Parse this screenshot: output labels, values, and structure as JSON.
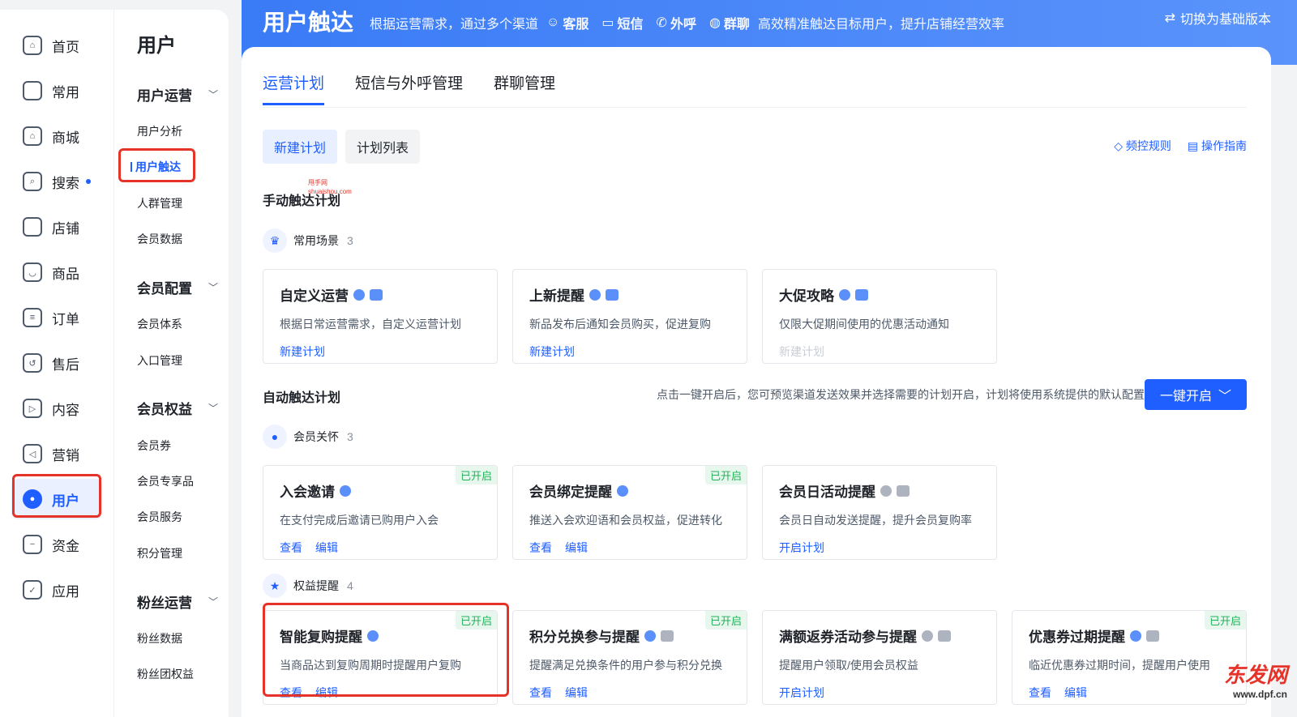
{
  "rail": {
    "items": [
      {
        "label": "首页",
        "icon": "home-icon"
      },
      {
        "label": "常用",
        "icon": "folder-icon"
      },
      {
        "label": "商城",
        "icon": "store-icon"
      },
      {
        "label": "搜索",
        "icon": "search-icon"
      },
      {
        "label": "店铺",
        "icon": "shop-icon"
      },
      {
        "label": "商品",
        "icon": "bag-icon"
      },
      {
        "label": "订单",
        "icon": "order-icon"
      },
      {
        "label": "售后",
        "icon": "aftersale-icon"
      },
      {
        "label": "内容",
        "icon": "content-icon"
      },
      {
        "label": "营销",
        "icon": "megaphone-icon"
      },
      {
        "label": "用户",
        "icon": "user-icon"
      },
      {
        "label": "资金",
        "icon": "wallet-icon"
      },
      {
        "label": "应用",
        "icon": "app-icon"
      }
    ]
  },
  "subnav": {
    "title": "用户",
    "groups": [
      "用户运营",
      "会员配置",
      "会员权益",
      "粉丝运营"
    ],
    "items": [
      "用户分析",
      "用户触达",
      "人群管理",
      "会员数据",
      "会员体系",
      "入口管理",
      "会员券",
      "会员专享品",
      "会员服务",
      "积分管理",
      "粉丝数据",
      "粉丝团权益"
    ]
  },
  "banner": {
    "title": "用户触达",
    "desc_prefix": "根据运营需求，通过多个渠道",
    "channels": [
      "客服",
      "短信",
      "外呼",
      "群聊"
    ],
    "desc_suffix": "高效精准触达目标用户，提升店铺经营效率",
    "switch": "切换为基础版本"
  },
  "tabs": [
    "运营计划",
    "短信与外呼管理",
    "群聊管理"
  ],
  "seg": [
    "新建计划",
    "计划列表"
  ],
  "links": [
    "频控规则",
    "操作指南"
  ],
  "manual": {
    "title": "手动触达计划",
    "watermark_1": "甩手网",
    "watermark_2": "shuaishou.com",
    "category": "常用场景",
    "count": "3",
    "cards": [
      {
        "title": "自定义运营",
        "desc": "根据日常运营需求，自定义运营计划",
        "action": "新建计划"
      },
      {
        "title": "上新提醒",
        "desc": "新品发布后通知会员购买，促进复购",
        "action": "新建计划"
      },
      {
        "title": "大促攻略",
        "desc": "仅限大促期间使用的优惠活动通知",
        "action": "新建计划"
      }
    ]
  },
  "auto": {
    "title": "自动触达计划",
    "note": "点击一键开启后，您可预览渠道发送效果并选择需要的计划开启，计划将使用系统提供的默认配置",
    "button": "一键开启",
    "cat1": {
      "label": "会员关怀",
      "count": "3"
    },
    "cat2": {
      "label": "权益提醒",
      "count": "4"
    },
    "badge": "已开启",
    "view": "查看",
    "edit": "编辑",
    "enable": "开启计划",
    "cards1": [
      {
        "title": "入会邀请",
        "desc": "在支付完成后邀请已购用户入会"
      },
      {
        "title": "会员绑定提醒",
        "desc": "推送入会欢迎语和会员权益，促进转化"
      },
      {
        "title": "会员日活动提醒",
        "desc": "会员日自动发送提醒，提升会员复购率"
      }
    ],
    "cards2": [
      {
        "title": "智能复购提醒",
        "desc": "当商品达到复购周期时提醒用户复购"
      },
      {
        "title": "积分兑换参与提醒",
        "desc": "提醒满足兑换条件的用户参与积分兑换"
      },
      {
        "title": "满额返券活动参与提醒",
        "desc": "提醒用户领取/使用会员权益"
      },
      {
        "title": "优惠券过期提醒",
        "desc": "临近优惠券过期时间，提醒用户使用"
      }
    ]
  },
  "corner_logo": {
    "name": "东发网",
    "url": "www.dpf.cn"
  },
  "colors": {
    "accent": "#1f5eff",
    "banner": "#3a7bf6",
    "success": "#23b25b",
    "highlight": "#e5332a"
  }
}
